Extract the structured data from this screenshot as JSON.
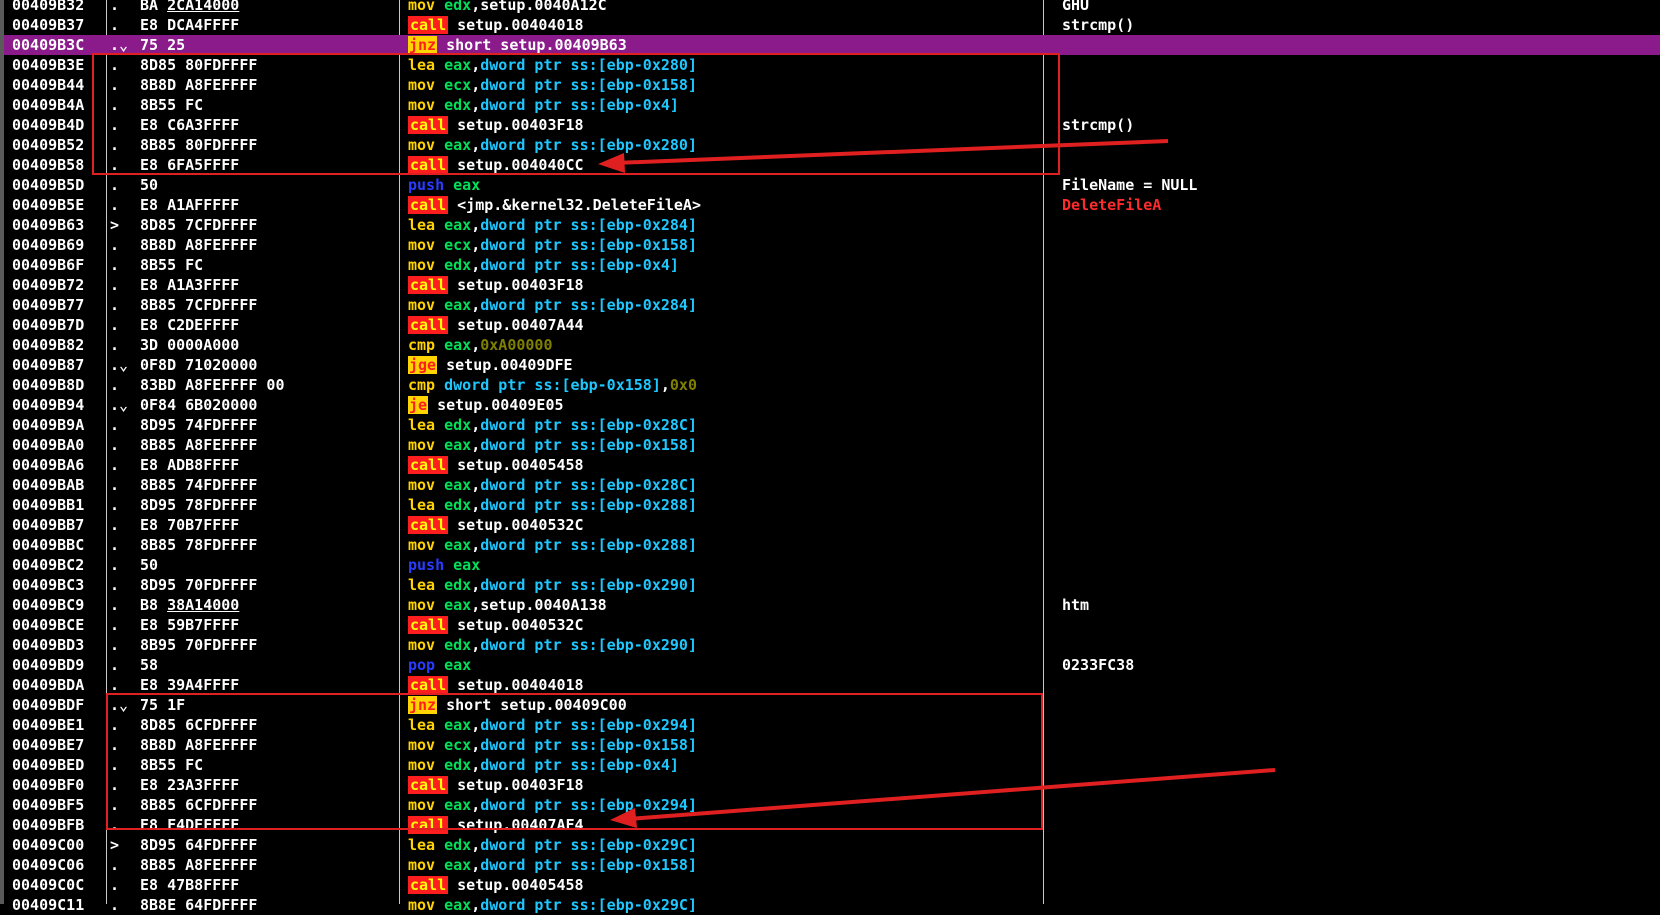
{
  "colors": {
    "background": "#000000",
    "selected_row": "#8b1a8b",
    "annotation": "#e02020"
  },
  "rows": [
    {
      "addr": "00409B32",
      "mark": ".",
      "bytes": "BA ",
      "bytes_u": "2CA14000",
      "mnem": "mov",
      "mclass": "mov",
      "args": [
        [
          "reg",
          "edx"
        ],
        [
          "plain",
          ",setup.0040A12C"
        ]
      ],
      "comment": "GHU"
    },
    {
      "addr": "00409B37",
      "mark": ".",
      "bytes": "E8 DCA4FFFF",
      "mnem": "call",
      "mclass": "call",
      "args": [
        [
          "plain",
          " setup.00404018"
        ]
      ],
      "comment": "strcmp()"
    },
    {
      "addr": "00409B3C",
      "mark": ".⌄",
      "bytes": "75 25",
      "mnem": "jnz",
      "mclass": "jnz",
      "args": [
        [
          "plain",
          " short setup.00409B63"
        ]
      ],
      "sel": true
    },
    {
      "addr": "00409B3E",
      "mark": ".",
      "bytes": "8D85 80FDFFFF",
      "mnem": "lea",
      "mclass": "lea",
      "args": [
        [
          "reg",
          "eax"
        ],
        [
          "plain",
          ","
        ],
        [
          "mem",
          "dword ptr ss:[ebp-0x280]"
        ]
      ]
    },
    {
      "addr": "00409B44",
      "mark": ".",
      "bytes": "8B8D A8FEFFFF",
      "mnem": "mov",
      "mclass": "mov",
      "args": [
        [
          "reg",
          "ecx"
        ],
        [
          "plain",
          ","
        ],
        [
          "mem",
          "dword ptr ss:[ebp-0x158]"
        ]
      ]
    },
    {
      "addr": "00409B4A",
      "mark": ".",
      "bytes": "8B55 FC",
      "mnem": "mov",
      "mclass": "mov",
      "args": [
        [
          "reg",
          "edx"
        ],
        [
          "plain",
          ","
        ],
        [
          "mem",
          "dword ptr ss:[ebp-0x4]"
        ]
      ]
    },
    {
      "addr": "00409B4D",
      "mark": ".",
      "bytes": "E8 C6A3FFFF",
      "mnem": "call",
      "mclass": "call",
      "args": [
        [
          "plain",
          " setup.00403F18"
        ]
      ],
      "comment": "strcmp()"
    },
    {
      "addr": "00409B52",
      "mark": ".",
      "bytes": "8B85 80FDFFFF",
      "mnem": "mov",
      "mclass": "mov",
      "args": [
        [
          "reg",
          "eax"
        ],
        [
          "plain",
          ","
        ],
        [
          "mem",
          "dword ptr ss:[ebp-0x280]"
        ]
      ]
    },
    {
      "addr": "00409B58",
      "mark": ".",
      "bytes": "E8 6FA5FFFF",
      "mnem": "call",
      "mclass": "call",
      "args": [
        [
          "plain",
          " setup.004040CC"
        ]
      ]
    },
    {
      "addr": "00409B5D",
      "mark": ".",
      "bytes": "50",
      "mnem": "push",
      "mclass": "push",
      "args": [
        [
          "reg",
          "eax"
        ]
      ],
      "comment": "FileName = NULL"
    },
    {
      "addr": "00409B5E",
      "mark": ".",
      "bytes": "E8 A1AFFFFF",
      "mnem": "call",
      "mclass": "call",
      "args": [
        [
          "plain",
          " <jmp.&kernel32.DeleteFileA>"
        ]
      ],
      "comment": "DeleteFileA",
      "comment_red": true
    },
    {
      "addr": "00409B63",
      "mark": ">",
      "bytes": "8D85 7CFDFFFF",
      "mnem": "lea",
      "mclass": "lea",
      "args": [
        [
          "reg",
          "eax"
        ],
        [
          "plain",
          ","
        ],
        [
          "mem",
          "dword ptr ss:[ebp-0x284]"
        ]
      ]
    },
    {
      "addr": "00409B69",
      "mark": ".",
      "bytes": "8B8D A8FEFFFF",
      "mnem": "mov",
      "mclass": "mov",
      "args": [
        [
          "reg",
          "ecx"
        ],
        [
          "plain",
          ","
        ],
        [
          "mem",
          "dword ptr ss:[ebp-0x158]"
        ]
      ]
    },
    {
      "addr": "00409B6F",
      "mark": ".",
      "bytes": "8B55 FC",
      "mnem": "mov",
      "mclass": "mov",
      "args": [
        [
          "reg",
          "edx"
        ],
        [
          "plain",
          ","
        ],
        [
          "mem",
          "dword ptr ss:[ebp-0x4]"
        ]
      ]
    },
    {
      "addr": "00409B72",
      "mark": ".",
      "bytes": "E8 A1A3FFFF",
      "mnem": "call",
      "mclass": "call",
      "args": [
        [
          "plain",
          " setup.00403F18"
        ]
      ]
    },
    {
      "addr": "00409B77",
      "mark": ".",
      "bytes": "8B85 7CFDFFFF",
      "mnem": "mov",
      "mclass": "mov",
      "args": [
        [
          "reg",
          "eax"
        ],
        [
          "plain",
          ","
        ],
        [
          "mem",
          "dword ptr ss:[ebp-0x284]"
        ]
      ]
    },
    {
      "addr": "00409B7D",
      "mark": ".",
      "bytes": "E8 C2DEFFFF",
      "mnem": "call",
      "mclass": "call",
      "args": [
        [
          "plain",
          " setup.00407A44"
        ]
      ]
    },
    {
      "addr": "00409B82",
      "mark": ".",
      "bytes": "3D 0000A000",
      "mnem": "cmp",
      "mclass": "cmp",
      "args": [
        [
          "reg",
          "eax"
        ],
        [
          "plain",
          ","
        ],
        [
          "imm",
          "0xA00000"
        ]
      ]
    },
    {
      "addr": "00409B87",
      "mark": ".⌄",
      "bytes": "0F8D 71020000",
      "mnem": "jge",
      "mclass": "jge",
      "args": [
        [
          "plain",
          " setup.00409DFE"
        ]
      ]
    },
    {
      "addr": "00409B8D",
      "mark": ".",
      "bytes": "83BD A8FEFFFF 00",
      "mnem": "cmp",
      "mclass": "cmp",
      "args": [
        [
          "mem",
          "dword ptr ss:[ebp-0x158]"
        ],
        [
          "plain",
          ","
        ],
        [
          "imm",
          "0x0"
        ]
      ]
    },
    {
      "addr": "00409B94",
      "mark": ".⌄",
      "bytes": "0F84 6B020000",
      "mnem": "je",
      "mclass": "je",
      "args": [
        [
          "plain",
          " setup.00409E05"
        ]
      ]
    },
    {
      "addr": "00409B9A",
      "mark": ".",
      "bytes": "8D95 74FDFFFF",
      "mnem": "lea",
      "mclass": "lea",
      "args": [
        [
          "reg",
          "edx"
        ],
        [
          "plain",
          ","
        ],
        [
          "mem",
          "dword ptr ss:[ebp-0x28C]"
        ]
      ]
    },
    {
      "addr": "00409BA0",
      "mark": ".",
      "bytes": "8B85 A8FEFFFF",
      "mnem": "mov",
      "mclass": "mov",
      "args": [
        [
          "reg",
          "eax"
        ],
        [
          "plain",
          ","
        ],
        [
          "mem",
          "dword ptr ss:[ebp-0x158]"
        ]
      ]
    },
    {
      "addr": "00409BA6",
      "mark": ".",
      "bytes": "E8 ADB8FFFF",
      "mnem": "call",
      "mclass": "call",
      "args": [
        [
          "plain",
          " setup.00405458"
        ]
      ]
    },
    {
      "addr": "00409BAB",
      "mark": ".",
      "bytes": "8B85 74FDFFFF",
      "mnem": "mov",
      "mclass": "mov",
      "args": [
        [
          "reg",
          "eax"
        ],
        [
          "plain",
          ","
        ],
        [
          "mem",
          "dword ptr ss:[ebp-0x28C]"
        ]
      ]
    },
    {
      "addr": "00409BB1",
      "mark": ".",
      "bytes": "8D95 78FDFFFF",
      "mnem": "lea",
      "mclass": "lea",
      "args": [
        [
          "reg",
          "edx"
        ],
        [
          "plain",
          ","
        ],
        [
          "mem",
          "dword ptr ss:[ebp-0x288]"
        ]
      ]
    },
    {
      "addr": "00409BB7",
      "mark": ".",
      "bytes": "E8 70B7FFFF",
      "mnem": "call",
      "mclass": "call",
      "args": [
        [
          "plain",
          " setup.0040532C"
        ]
      ]
    },
    {
      "addr": "00409BBC",
      "mark": ".",
      "bytes": "8B85 78FDFFFF",
      "mnem": "mov",
      "mclass": "mov",
      "args": [
        [
          "reg",
          "eax"
        ],
        [
          "plain",
          ","
        ],
        [
          "mem",
          "dword ptr ss:[ebp-0x288]"
        ]
      ]
    },
    {
      "addr": "00409BC2",
      "mark": ".",
      "bytes": "50",
      "mnem": "push",
      "mclass": "push",
      "args": [
        [
          "reg",
          "eax"
        ]
      ]
    },
    {
      "addr": "00409BC3",
      "mark": ".",
      "bytes": "8D95 70FDFFFF",
      "mnem": "lea",
      "mclass": "lea",
      "args": [
        [
          "reg",
          "edx"
        ],
        [
          "plain",
          ","
        ],
        [
          "mem",
          "dword ptr ss:[ebp-0x290]"
        ]
      ]
    },
    {
      "addr": "00409BC9",
      "mark": ".",
      "bytes": "B8 ",
      "bytes_u": "38A14000",
      "mnem": "mov",
      "mclass": "mov",
      "args": [
        [
          "reg",
          "eax"
        ],
        [
          "plain",
          ",setup.0040A138"
        ]
      ],
      "comment": "htm"
    },
    {
      "addr": "00409BCE",
      "mark": ".",
      "bytes": "E8 59B7FFFF",
      "mnem": "call",
      "mclass": "call",
      "args": [
        [
          "plain",
          " setup.0040532C"
        ]
      ]
    },
    {
      "addr": "00409BD3",
      "mark": ".",
      "bytes": "8B95 70FDFFFF",
      "mnem": "mov",
      "mclass": "mov",
      "args": [
        [
          "reg",
          "edx"
        ],
        [
          "plain",
          ","
        ],
        [
          "mem",
          "dword ptr ss:[ebp-0x290]"
        ]
      ]
    },
    {
      "addr": "00409BD9",
      "mark": ".",
      "bytes": "58",
      "mnem": "pop",
      "mclass": "pop",
      "args": [
        [
          "reg",
          "eax"
        ]
      ],
      "comment": "0233FC38"
    },
    {
      "addr": "00409BDA",
      "mark": ".",
      "bytes": "E8 39A4FFFF",
      "mnem": "call",
      "mclass": "call",
      "args": [
        [
          "plain",
          " setup.00404018"
        ]
      ]
    },
    {
      "addr": "00409BDF",
      "mark": ".⌄",
      "bytes": "75 1F",
      "mnem": "jnz",
      "mclass": "jnz",
      "args": [
        [
          "plain",
          " short setup.00409C00"
        ]
      ]
    },
    {
      "addr": "00409BE1",
      "mark": ".",
      "bytes": "8D85 6CFDFFFF",
      "mnem": "lea",
      "mclass": "lea",
      "args": [
        [
          "reg",
          "eax"
        ],
        [
          "plain",
          ","
        ],
        [
          "mem",
          "dword ptr ss:[ebp-0x294]"
        ]
      ]
    },
    {
      "addr": "00409BE7",
      "mark": ".",
      "bytes": "8B8D A8FEFFFF",
      "mnem": "mov",
      "mclass": "mov",
      "args": [
        [
          "reg",
          "ecx"
        ],
        [
          "plain",
          ","
        ],
        [
          "mem",
          "dword ptr ss:[ebp-0x158]"
        ]
      ]
    },
    {
      "addr": "00409BED",
      "mark": ".",
      "bytes": "8B55 FC",
      "mnem": "mov",
      "mclass": "mov",
      "args": [
        [
          "reg",
          "edx"
        ],
        [
          "plain",
          ","
        ],
        [
          "mem",
          "dword ptr ss:[ebp-0x4]"
        ]
      ]
    },
    {
      "addr": "00409BF0",
      "mark": ".",
      "bytes": "E8 23A3FFFF",
      "mnem": "call",
      "mclass": "call",
      "args": [
        [
          "plain",
          " setup.00403F18"
        ]
      ]
    },
    {
      "addr": "00409BF5",
      "mark": ".",
      "bytes": "8B85 6CFDFFFF",
      "mnem": "mov",
      "mclass": "mov",
      "args": [
        [
          "reg",
          "eax"
        ],
        [
          "plain",
          ","
        ],
        [
          "mem",
          "dword ptr ss:[ebp-0x294]"
        ]
      ]
    },
    {
      "addr": "00409BFB",
      "mark": ".",
      "bytes": "E8 F4DEFFFF",
      "mnem": "call",
      "mclass": "call",
      "args": [
        [
          "plain",
          " setup.00407AF4"
        ]
      ]
    },
    {
      "addr": "00409C00",
      "mark": ">",
      "bytes": "8D95 64FDFFFF",
      "mnem": "lea",
      "mclass": "lea",
      "args": [
        [
          "reg",
          "edx"
        ],
        [
          "plain",
          ","
        ],
        [
          "mem",
          "dword ptr ss:[ebp-0x29C]"
        ]
      ]
    },
    {
      "addr": "00409C06",
      "mark": ".",
      "bytes": "8B85 A8FEFFFF",
      "mnem": "mov",
      "mclass": "mov",
      "args": [
        [
          "reg",
          "eax"
        ],
        [
          "plain",
          ","
        ],
        [
          "mem",
          "dword ptr ss:[ebp-0x158]"
        ]
      ]
    },
    {
      "addr": "00409C0C",
      "mark": ".",
      "bytes": "E8 47B8FFFF",
      "mnem": "call",
      "mclass": "call",
      "args": [
        [
          "plain",
          " setup.00405458"
        ]
      ]
    },
    {
      "addr": "00409C11",
      "mark": ".",
      "bytes": "8B8E 64FDFFFF",
      "mnem": "mov",
      "mclass": "mov",
      "args": [
        [
          "reg",
          "eax"
        ],
        [
          "plain",
          ","
        ],
        [
          "mem",
          "dword ptr ss:[ebp-0x29C]"
        ]
      ]
    }
  ]
}
